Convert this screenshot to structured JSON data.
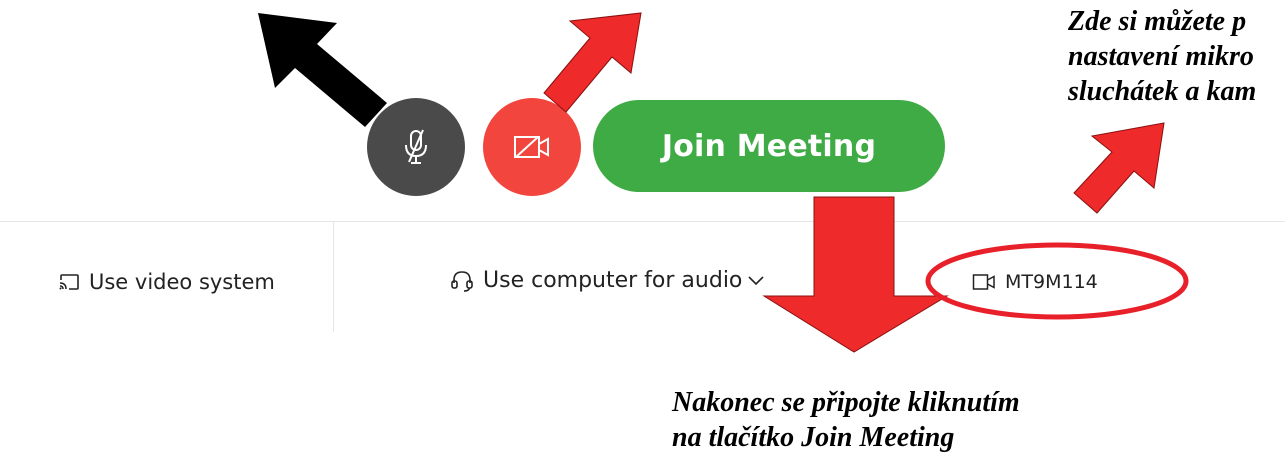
{
  "controls": {
    "mute_icon": "microphone-muted-icon",
    "video_icon": "camera-off-icon",
    "join_label": "Join Meeting"
  },
  "bottom_bar": {
    "video_system_label": "Use video system",
    "audio_label": "Use computer for audio",
    "camera_label": "MT9M114"
  },
  "annotations": {
    "top_right_lines": [
      "Zde si můžete p",
      "nastavení mikro",
      "sluchátek a kam"
    ],
    "bottom_lines": [
      "Nakonec se připojte kliknutím",
      "na tlačítko Join Meeting"
    ]
  },
  "colors": {
    "mute_bg": "#4a4a4a",
    "video_bg": "#f1453d",
    "join_bg": "#3fab45",
    "arrow_red": "#ee2a2a",
    "arrow_black": "#000000",
    "ellipse_red": "#e8202a"
  }
}
